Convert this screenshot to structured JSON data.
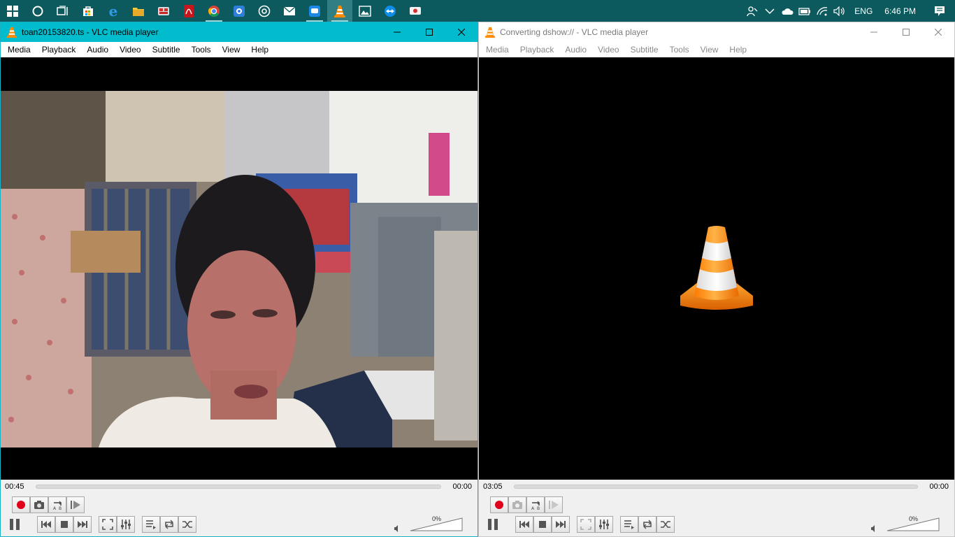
{
  "taskbar": {
    "apps": [
      {
        "name": "start-icon",
        "active": false,
        "running": false
      },
      {
        "name": "cortana-icon",
        "active": false,
        "running": false
      },
      {
        "name": "task-view-icon",
        "active": false,
        "running": false
      },
      {
        "name": "store-icon",
        "active": false,
        "running": false
      },
      {
        "name": "edge-icon",
        "active": false,
        "running": false
      },
      {
        "name": "file-explorer-icon",
        "active": false,
        "running": false
      },
      {
        "name": "app-red-icon",
        "active": false,
        "running": false
      },
      {
        "name": "acrobat-icon",
        "active": false,
        "running": false
      },
      {
        "name": "chrome-icon",
        "active": false,
        "running": true
      },
      {
        "name": "app-blue-icon",
        "active": false,
        "running": false
      },
      {
        "name": "media-app-icon",
        "active": false,
        "running": false
      },
      {
        "name": "mail-icon",
        "active": false,
        "running": false
      },
      {
        "name": "chat-app-icon",
        "active": false,
        "running": true
      },
      {
        "name": "vlc-icon",
        "active": true,
        "running": true
      },
      {
        "name": "photos-icon",
        "active": false,
        "running": false
      },
      {
        "name": "teamviewer-icon",
        "active": false,
        "running": false
      },
      {
        "name": "remote-app-icon",
        "active": false,
        "running": false
      }
    ],
    "language": "ENG",
    "clock": "6:46 PM"
  },
  "left_window": {
    "title": "toan20153820.ts - VLC media player",
    "menu": [
      "Media",
      "Playback",
      "Audio",
      "Video",
      "Subtitle",
      "Tools",
      "View",
      "Help"
    ],
    "time_elapsed": "00:45",
    "time_total": "00:00",
    "volume": "0%"
  },
  "right_window": {
    "title": "Converting dshow:// - VLC media player",
    "menu": [
      "Media",
      "Playback",
      "Audio",
      "Video",
      "Subtitle",
      "Tools",
      "View",
      "Help"
    ],
    "time_elapsed": "03:05",
    "time_total": "00:00",
    "volume": "0%"
  },
  "colors": {
    "taskbar": "#0d5a5e",
    "active_title": "#00bccd",
    "vlc_orange": "#ff8a00",
    "record_red": "#e0001b"
  }
}
